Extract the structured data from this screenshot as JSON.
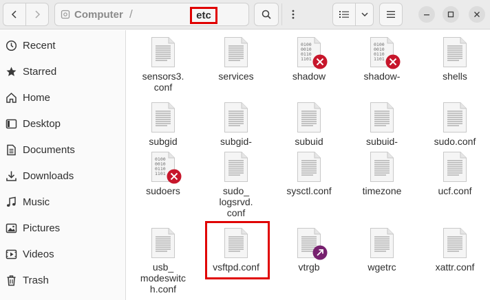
{
  "header": {
    "breadcrumb_root": "Computer",
    "breadcrumb_separator": "/",
    "breadcrumb_current": "etc"
  },
  "sidebar": {
    "items": [
      {
        "label": "Recent",
        "icon": "clock-icon"
      },
      {
        "label": "Starred",
        "icon": "star-icon"
      },
      {
        "label": "Home",
        "icon": "home-icon"
      },
      {
        "label": "Desktop",
        "icon": "desktop-icon"
      },
      {
        "label": "Documents",
        "icon": "documents-icon"
      },
      {
        "label": "Downloads",
        "icon": "download-icon"
      },
      {
        "label": "Music",
        "icon": "music-icon"
      },
      {
        "label": "Pictures",
        "icon": "pictures-icon"
      },
      {
        "label": "Videos",
        "icon": "videos-icon"
      },
      {
        "label": "Trash",
        "icon": "trash-icon"
      }
    ]
  },
  "files": [
    {
      "name": "sensors3.\nconf",
      "type": "text"
    },
    {
      "name": "services",
      "type": "text"
    },
    {
      "name": "shadow",
      "type": "binary-locked"
    },
    {
      "name": "shadow-",
      "type": "binary-locked"
    },
    {
      "name": "shells",
      "type": "text"
    },
    {
      "name": "subgid",
      "type": "text"
    },
    {
      "name": "subgid-",
      "type": "text"
    },
    {
      "name": "subuid",
      "type": "text"
    },
    {
      "name": "subuid-",
      "type": "text"
    },
    {
      "name": "sudo.conf",
      "type": "text"
    },
    {
      "name": "sudoers",
      "type": "binary-locked"
    },
    {
      "name": "sudo_\nlogsrvd.\nconf",
      "type": "text"
    },
    {
      "name": "sysctl.conf",
      "type": "text"
    },
    {
      "name": "timezone",
      "type": "text"
    },
    {
      "name": "ucf.conf",
      "type": "text"
    },
    {
      "name": "usb_\nmodeswitc\nh.conf",
      "type": "text"
    },
    {
      "name": "vsftpd.conf",
      "type": "text"
    },
    {
      "name": "vtrgb",
      "type": "link"
    },
    {
      "name": "wgetrc",
      "type": "text"
    },
    {
      "name": "xattr.conf",
      "type": "text"
    }
  ],
  "colors": {
    "annotation": "#e00000",
    "locked_badge": "#c7162b",
    "link_badge": "#77216f"
  }
}
